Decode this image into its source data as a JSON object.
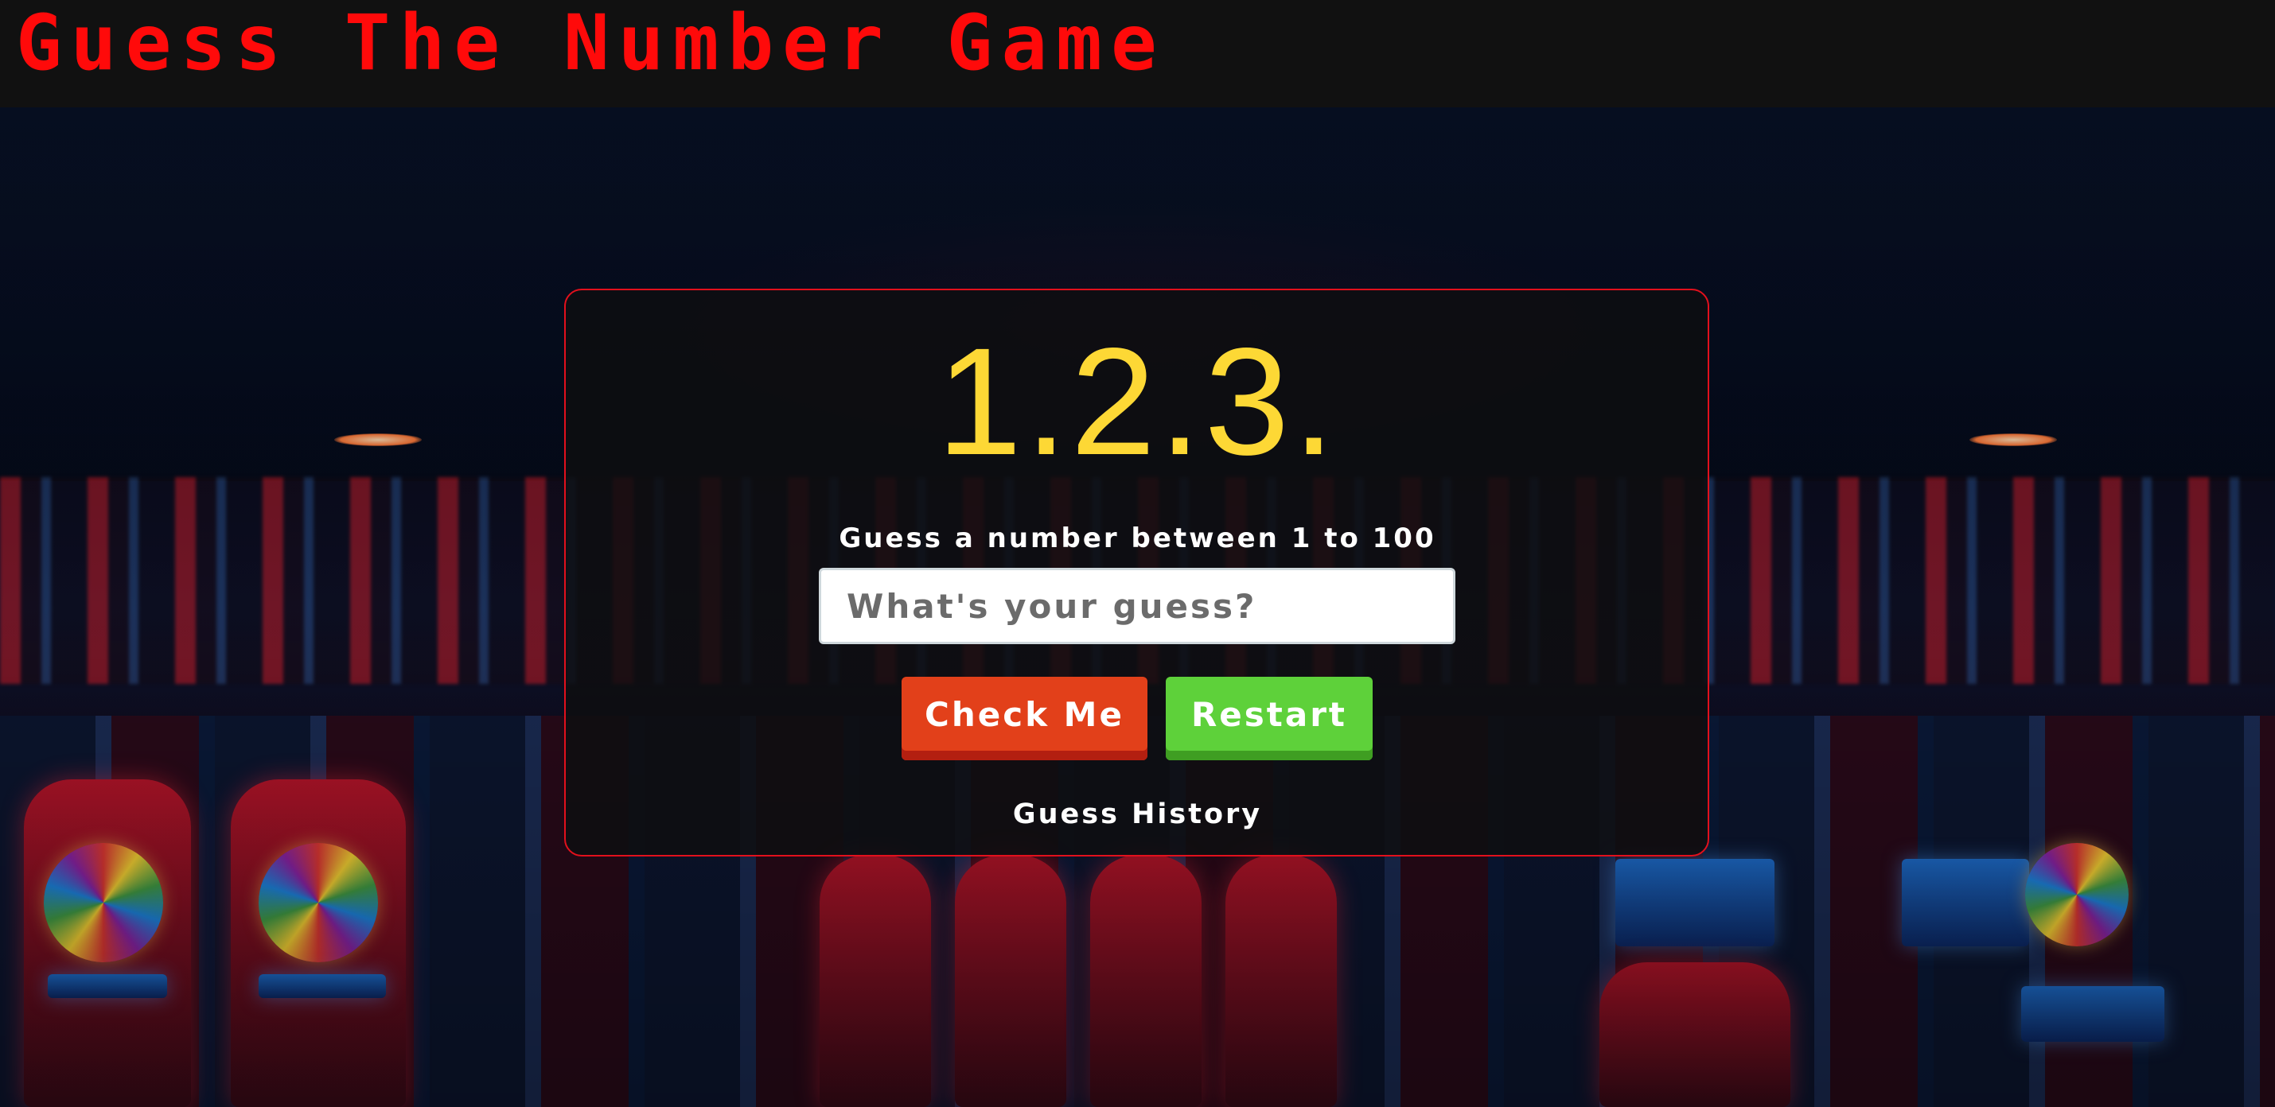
{
  "header": {
    "title": "Guess The Number Game"
  },
  "game": {
    "digits_display": "1.2.3.",
    "prompt": "Guess a number between 1 to 100",
    "input": {
      "placeholder": "What's your guess?",
      "value": ""
    },
    "check_button_label": "Check Me",
    "restart_button_label": "Restart",
    "history_label": "Guess History"
  },
  "colors": {
    "header_background": "#111111",
    "title": "#ff0a0a",
    "card_border": "#e2101c",
    "digits": "#fdd835",
    "check_button": "#e2401a",
    "restart_button": "#5ed13a"
  }
}
